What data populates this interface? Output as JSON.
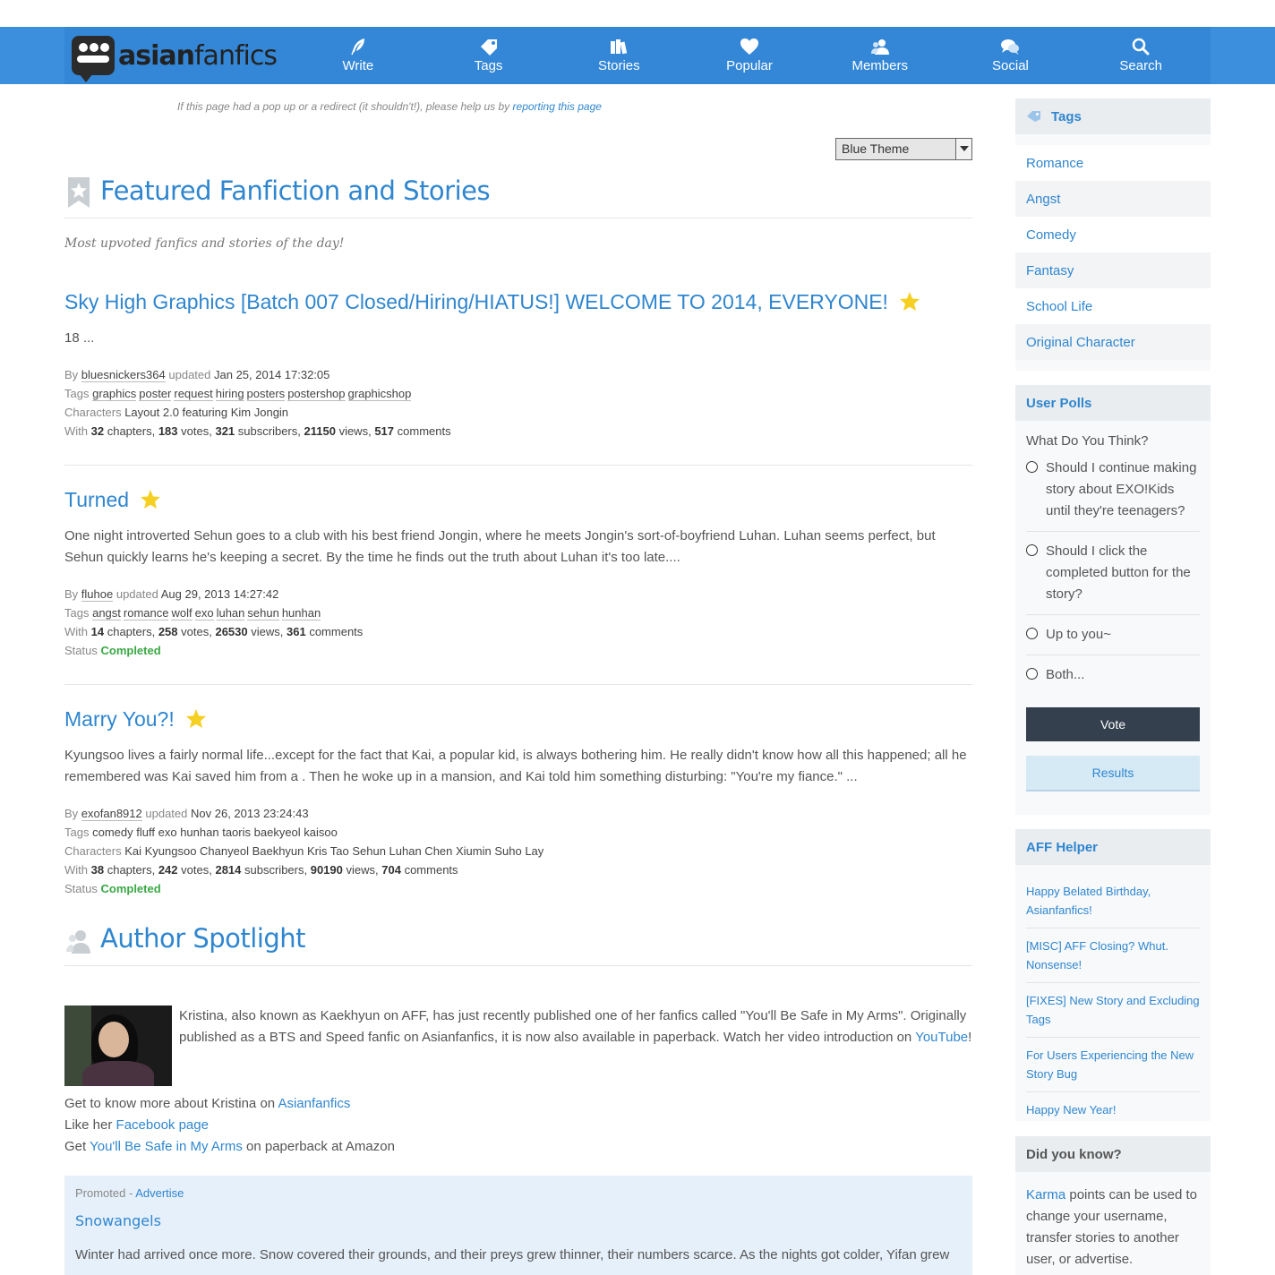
{
  "header": {
    "logo_bold": "asian",
    "logo_light": "fanfics",
    "nav": [
      {
        "label": "Write",
        "icon": "quill-icon"
      },
      {
        "label": "Tags",
        "icon": "tags-icon"
      },
      {
        "label": "Stories",
        "icon": "books-icon"
      },
      {
        "label": "Popular",
        "icon": "heart-icon"
      },
      {
        "label": "Members",
        "icon": "members-icon"
      },
      {
        "label": "Social",
        "icon": "chat-bubbles-icon"
      },
      {
        "label": "Search",
        "icon": "search-icon"
      }
    ]
  },
  "notice": {
    "text": "If this page had a pop up or a redirect (it shouldn't!), please help us by",
    "link": "reporting this page"
  },
  "theme_select": {
    "value": "Blue Theme"
  },
  "featured": {
    "title": "Featured Fanfiction and Stories",
    "subtitle": "Most upvoted fanfics and stories of the day!"
  },
  "labels": {
    "by": "By",
    "updated": "updated",
    "tags": "Tags",
    "characters": "Characters",
    "with": "With",
    "chapters": "chapters,",
    "votes": "votes,",
    "subscribers": "subscribers,",
    "views": "views,",
    "comments": "comments",
    "status": "Status"
  },
  "stories": [
    {
      "title": "Sky High Graphics [Batch 007 Closed/Hiring/HIATUS!] WELCOME TO 2014, EVERYONE!",
      "desc": "18 ...",
      "author": "bluesnickers364",
      "updated": "Jan 25, 2014 17:32:05",
      "tags": [
        "graphics",
        "poster",
        "request",
        "hiring",
        "posters",
        "postershop",
        "graphicshop"
      ],
      "characters": "Layout 2.0 featuring Kim Jongin",
      "chapters": "32",
      "votes": "183",
      "subscribers": "321",
      "views": "21150",
      "comments": "517"
    },
    {
      "title": "Turned",
      "desc": "One night introverted Sehun goes to a club with his best friend Jongin, where he meets Jongin's sort-of-boyfriend Luhan. Luhan seems perfect, but Sehun quickly learns he's keeping a secret. By the time he finds out the truth about Luhan it's too late....",
      "author": "fluhoe",
      "updated": "Aug 29, 2013 14:27:42",
      "tags": [
        "angst",
        "romance",
        "wolf",
        "exo",
        "luhan",
        "sehun",
        "hunhan"
      ],
      "chapters": "14",
      "votes": "258",
      "views": "26530",
      "comments": "361",
      "status": "Completed"
    },
    {
      "title": "Marry You?!",
      "desc": "Kyungsoo lives a fairly normal life...except for the fact that Kai, a popular kid, is always bothering him. He really didn't know how all this happened; all he remembered was Kai saved him from a . Then he woke up in a mansion, and Kai told him something disturbing:  \"You're my fiance.\"  ...",
      "author": "exofan8912",
      "updated": "Nov 26, 2013 23:24:43",
      "tags": [
        "comedy",
        "fluff",
        "exo",
        "hunhan",
        "taoris",
        "baekyeol",
        "kaisoo"
      ],
      "characters": "Kai Kyungsoo Chanyeol Baekhyun Kris Tao Sehun Luhan Chen Xiumin Suho Lay",
      "chapters": "38",
      "votes": "242",
      "subscribers": "2814",
      "views": "90190",
      "comments": "704",
      "status": "Completed"
    }
  ],
  "spotlight": {
    "title": "Author Spotlight",
    "text": "Kristina, also known as Kaekhyun on AFF, has just recently published one of her fanfics called \"You'll Be Safe in My Arms\". Originally published as a BTS and Speed fanfic on Asianfanfics, it is now also available in paperback. Watch her video introduction on",
    "youtube": "YouTube",
    "excl": "!",
    "line1_pre": "Get to know more about Kristina on",
    "line1_link": "Asianfanfics",
    "line2_pre": "Like her",
    "line2_link": "Facebook page",
    "line3_pre": "Get",
    "line3_link": "You'll Be Safe in My Arms",
    "line3_post": "on paperback at Amazon"
  },
  "promo": {
    "label": "Promoted -",
    "advertise": "Advertise",
    "title": "Snowangels",
    "desc": "Winter had arrived once more. Snow covered their grounds, and their preys grew thinner, their numbers scarce. As the nights got colder, Yifan grew"
  },
  "sidebar": {
    "tags_title": "Tags",
    "tags": [
      "Romance",
      "Angst",
      "Comedy",
      "Fantasy",
      "School Life",
      "Original Character"
    ],
    "polls_title": "User Polls",
    "poll_question": "What Do You Think?",
    "poll_options": [
      "Should I continue making story about EXO!Kids until they're teenagers?",
      "Should I click the completed button for the story?",
      "Up to you~",
      "Both..."
    ],
    "vote": "Vote",
    "results": "Results",
    "helper_title": "AFF Helper",
    "helper_items": [
      "Happy Belated Birthday, Asianfanfics!",
      "[MISC] AFF Closing? Whut. Nonsense!",
      "[FIXES] New Story and Excluding Tags",
      "For Users Experiencing the New Story Bug",
      "Happy New Year!"
    ],
    "dyk_title": "Did you know?",
    "dyk_link": "Karma",
    "dyk_text": "points can be used to change your username, transfer stories to another user, or advertise."
  }
}
